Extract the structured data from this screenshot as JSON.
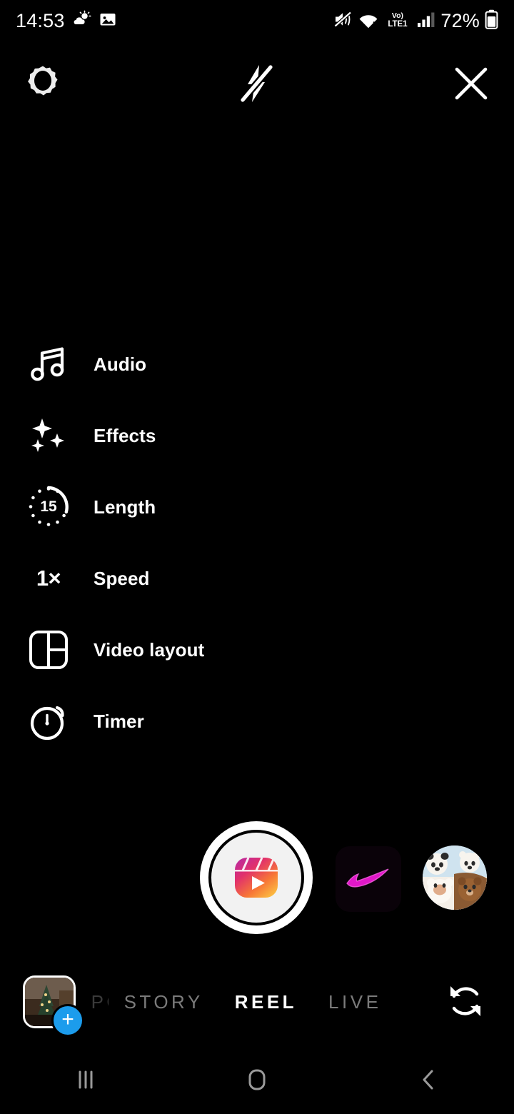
{
  "status_bar": {
    "time": "14:53",
    "battery_percent": "72%",
    "network_label": "Vo)",
    "network_sub": "LTE1",
    "icons": [
      "weather-sun-cloud-icon",
      "gallery-notification-icon",
      "vibrate-mute-icon",
      "wifi-icon",
      "volte-icon",
      "signal-bars-icon",
      "battery-icon"
    ]
  },
  "top_bar": {
    "settings_label": "Settings",
    "flash_label": "Flash off",
    "close_label": "Close",
    "icons": [
      "gear-icon",
      "flash-off-icon",
      "close-icon"
    ]
  },
  "tools": [
    {
      "label": "Audio",
      "icon": "music-note-icon"
    },
    {
      "label": "Effects",
      "icon": "sparkles-icon"
    },
    {
      "label": "Length",
      "icon": "length-dial-icon",
      "value": "15"
    },
    {
      "label": "Speed",
      "icon": "speed-icon",
      "value": "1×"
    },
    {
      "label": "Video layout",
      "icon": "video-layout-icon"
    },
    {
      "label": "Timer",
      "icon": "stopwatch-icon"
    }
  ],
  "capture": {
    "shutter_label": "Record reel",
    "shutter_icon": "reels-clapper-icon",
    "effect_tile_label": "Swoosh effect",
    "effect_tile_icon": "neon-swoosh-icon",
    "avatar_label": "Effect creator avatar",
    "avatar_icon": "bears-avatar-icon"
  },
  "bottom_bar": {
    "gallery_label": "Gallery",
    "gallery_badge": "+",
    "tabs": [
      {
        "label": "POST",
        "active": false,
        "clipped": true
      },
      {
        "label": "STORY",
        "active": false,
        "clipped": false
      },
      {
        "label": "REEL",
        "active": true,
        "clipped": false
      },
      {
        "label": "LIVE",
        "active": false,
        "clipped": false
      }
    ],
    "flip_label": "Switch camera",
    "flip_icon": "camera-flip-icon"
  },
  "nav_bar": {
    "recents_label": "Recents",
    "home_label": "Home",
    "back_label": "Back",
    "icons": [
      "recents-icon",
      "home-icon",
      "back-icon"
    ]
  },
  "colors": {
    "background": "#000000",
    "foreground": "#ffffff",
    "inactive_tab": "#7b7b7b",
    "badge_blue": "#1c9cec",
    "reels_pink": "#d62976",
    "reels_purple": "#962fbf",
    "reels_orange": "#fa7e1e",
    "reels_yellow": "#feda75",
    "neon_magenta": "#e018c8"
  }
}
